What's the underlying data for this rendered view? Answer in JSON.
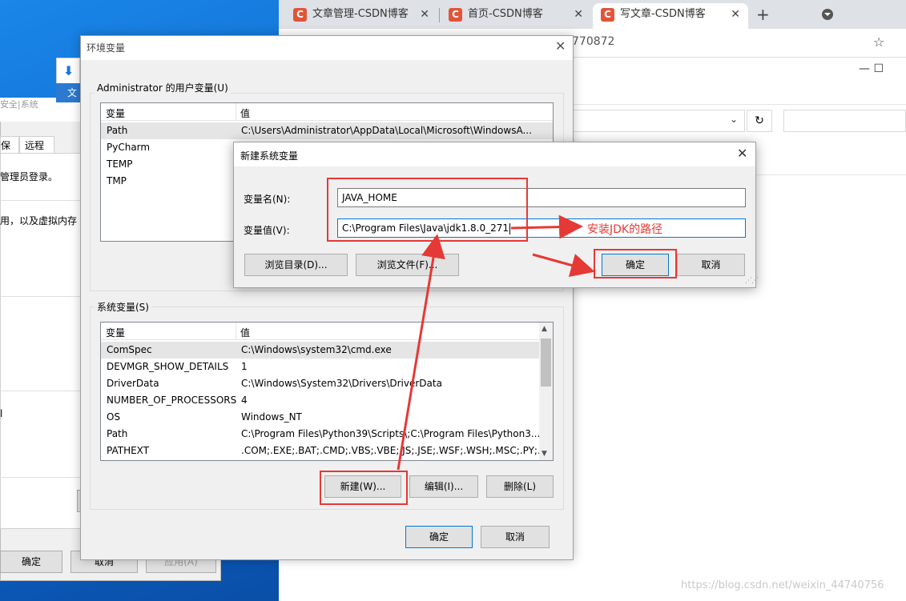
{
  "browser": {
    "tabs": [
      {
        "label": "文章管理-CSDN博客",
        "logo": "C"
      },
      {
        "label": "首页-CSDN博客",
        "logo": "C"
      },
      {
        "label": "写文章-CSDN博客",
        "logo": "C"
      }
    ],
    "new_tab": "+",
    "close_glyph": "✕",
    "url_fragment": "770872",
    "star_icon": "☆"
  },
  "explorer": {
    "window_controls": "—    ☐",
    "refresh_icon": "↻",
    "chevron": "⌄"
  },
  "download": {
    "label": "文"
  },
  "system_properties": {
    "tab_partial_1": "安全|系统",
    "tabs": [
      "保护",
      "远程"
    ],
    "text_1": "管理员登录。",
    "text_2": "用，以及虚拟内存",
    "text_3": "l",
    "buttons": {
      "ok": "确定",
      "cancel": "取消",
      "apply": "应用(A)"
    }
  },
  "env_dialog": {
    "title": "环境变量",
    "close": "✕",
    "user_group_label": "Administrator 的用户变量(U)",
    "columns": {
      "var": "变量",
      "val": "值"
    },
    "user_vars": [
      {
        "name": "Path",
        "value": "C:\\Users\\Administrator\\AppData\\Local\\Microsoft\\WindowsA..."
      },
      {
        "name": "PyCharm",
        "value": ""
      },
      {
        "name": "TEMP",
        "value": ""
      },
      {
        "name": "TMP",
        "value": ""
      }
    ],
    "system_group_label": "系统变量(S)",
    "system_vars": [
      {
        "name": "ComSpec",
        "value": "C:\\Windows\\system32\\cmd.exe"
      },
      {
        "name": "DEVMGR_SHOW_DETAILS",
        "value": "1"
      },
      {
        "name": "DriverData",
        "value": "C:\\Windows\\System32\\Drivers\\DriverData"
      },
      {
        "name": "NUMBER_OF_PROCESSORS",
        "value": "4"
      },
      {
        "name": "OS",
        "value": "Windows_NT"
      },
      {
        "name": "Path",
        "value": "C:\\Program Files\\Python39\\Scripts\\;C:\\Program Files\\Python3..."
      },
      {
        "name": "PATHEXT",
        "value": ".COM;.EXE;.BAT;.CMD;.VBS;.VBE;.JS;.JSE;.WSF;.WSH;.MSC;.PY;.P..."
      }
    ],
    "buttons": {
      "new": "新建(W)...",
      "edit": "编辑(I)...",
      "delete": "删除(L)",
      "ok": "确定",
      "cancel": "取消"
    }
  },
  "new_var_dialog": {
    "title": "新建系统变量",
    "close": "✕",
    "name_label": "变量名(N):",
    "name_value": "JAVA_HOME",
    "value_label": "变量值(V):",
    "value_value": "C:\\Program Files\\Java\\jdk1.8.0_271",
    "buttons": {
      "browse_dir": "浏览目录(D)...",
      "browse_file": "浏览文件(F)...",
      "ok": "确定",
      "cancel": "取消"
    }
  },
  "annotation": {
    "text": "安装JDK的路径"
  },
  "watermark": "https://blog.csdn.net/weixin_44740756",
  "colors": {
    "accent": "#0078d7",
    "annotation": "#e53935",
    "csdn": "#e0553a"
  }
}
